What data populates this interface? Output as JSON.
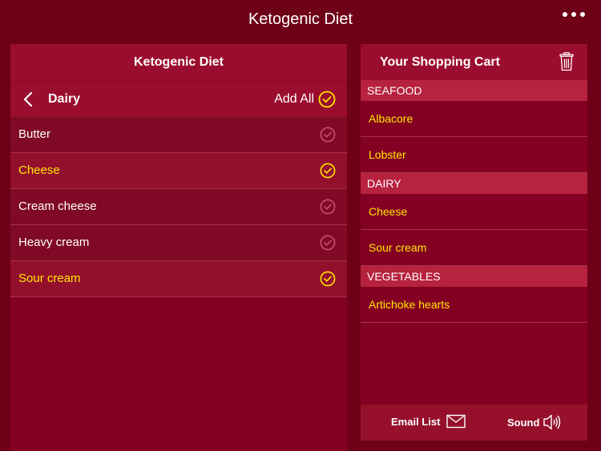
{
  "app": {
    "title": "Ketogenic Diet"
  },
  "icons": {
    "menu": "more-icon",
    "back": "chevron-left-icon",
    "check": "check-circle-icon",
    "trash": "trash-icon",
    "mail": "mail-icon",
    "sound": "speaker-icon"
  },
  "colors": {
    "background": "#6e0018",
    "panel": "#840022",
    "header": "#9b0d2e",
    "section": "#b7223f",
    "selected_text": "#ffe600"
  },
  "left_panel": {
    "header": "Ketogenic Diet",
    "nav_title": "Dairy",
    "add_all_label": "Add All",
    "items": [
      {
        "label": "Butter",
        "selected": false
      },
      {
        "label": "Cheese",
        "selected": true
      },
      {
        "label": "Cream cheese",
        "selected": false
      },
      {
        "label": "Heavy cream",
        "selected": false
      },
      {
        "label": "Sour cream",
        "selected": true
      }
    ]
  },
  "cart": {
    "title": "Your Shopping Cart",
    "sections": [
      {
        "name": "SEAFOOD",
        "items": [
          "Albacore",
          "Lobster"
        ]
      },
      {
        "name": "DAIRY",
        "items": [
          "Cheese",
          "Sour cream"
        ]
      },
      {
        "name": "VEGETABLES",
        "items": [
          "Artichoke hearts"
        ]
      }
    ],
    "email_label": "Email List",
    "sound_label": "Sound"
  }
}
